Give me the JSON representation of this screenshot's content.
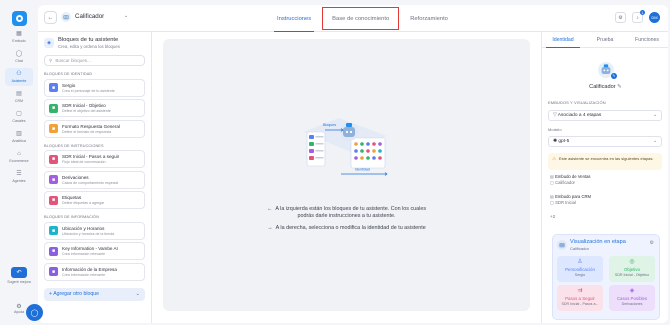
{
  "nav": {
    "items": [
      {
        "label": "Embudo",
        "icon": "grid-icon"
      },
      {
        "label": "Chat",
        "icon": "chat-icon"
      },
      {
        "label": "Asistente",
        "icon": "assistant-icon",
        "active": true
      },
      {
        "label": "CRM",
        "icon": "crm-icon"
      },
      {
        "label": "Canales",
        "icon": "channels-icon"
      },
      {
        "label": "Analítica",
        "icon": "analytics-icon"
      },
      {
        "label": "Ecommerce",
        "icon": "store-icon"
      },
      {
        "label": "Agentes",
        "icon": "agents-icon"
      }
    ],
    "bottom_label": "Sugerir mejora",
    "help_label": "Ayuda"
  },
  "header": {
    "assistant_name": "Calificador",
    "tabs": [
      "Instrucciones",
      "Base de conocimiento",
      "Reforzamiento"
    ],
    "active_tab": 0,
    "highlighted_tab": 1,
    "notification_count": "1",
    "user_initials": "DM"
  },
  "blocks": {
    "title": "Bloques de tu asistente",
    "subtitle": "Crea, edita y ordena los bloques",
    "search_placeholder": "Buscar bloques...",
    "sections": [
      {
        "label": "BLOQUES DE IDENTIDAD",
        "items": [
          {
            "title": "Sergio",
            "subtitle": "Crea el personaje de tu asistente",
            "color": "#5b7ff2"
          },
          {
            "title": "SDR Inicial - Objetivo",
            "subtitle": "Define el objetivo del asistente",
            "color": "#34b36b"
          },
          {
            "title": "Formato Respuesta General",
            "subtitle": "Define el formato de respuesta",
            "color": "#f0a23a"
          }
        ]
      },
      {
        "label": "BLOQUES DE INSTRUCCIONES",
        "items": [
          {
            "title": "SDR Inicial - Pasos a seguir",
            "subtitle": "Flujo ideal de conversación",
            "color": "#e2557a"
          },
          {
            "title": "Derivaciones",
            "subtitle": "Casos de comportamiento especial",
            "color": "#a25fe0"
          },
          {
            "title": "Etiquetas",
            "subtitle": "Define etiquetas a agregar",
            "color": "#e2557a"
          }
        ]
      },
      {
        "label": "BLOQUES DE INFORMACIÓN",
        "items": [
          {
            "title": "Ubicación y Horarios",
            "subtitle": "Ubicación y horarios de la tienda",
            "color": "#1fb5c9"
          },
          {
            "title": "Key Information - Vambe AI",
            "subtitle": "Crea información relevante",
            "color": "#8a5fe0"
          },
          {
            "title": "Información de la Empresa",
            "subtitle": "Crea información relevante",
            "color": "#8a5fe0"
          }
        ]
      }
    ],
    "add_label": "Agregar otro bloque"
  },
  "canvas": {
    "line1": "A la izquierda están los bloques de tu asistente. Con los cuales",
    "line2": "podrás darle instrucciones a tu asistente.",
    "line3": "A la derecha, selecciona o modifica la identidad de tu asistente",
    "illus_label_top": "Bloques",
    "illus_label_bottom": "Identidad"
  },
  "identity": {
    "tabs": [
      "Identidad",
      "Prueba",
      "Funciones"
    ],
    "active_tab": 0,
    "name": "Calificador",
    "funnel_section": "EMBUDOS Y VISUALIZACIÓN",
    "funnel_value": "Asociado a 4 etapas",
    "model_section": "Modelo",
    "model_value": "gpt-5",
    "warning": "Este asistente se encuentra en las siguientes etapas:",
    "links": [
      {
        "title": "Embudo de Ventas",
        "stage": "Calificador"
      },
      {
        "title": "Embudo para CRM",
        "stage": "SDR Inicial"
      }
    ],
    "more": "+2",
    "viz": {
      "title": "Visualización en etapa",
      "subtitle": "Calificador",
      "cards": [
        {
          "title": "Personificación",
          "sub": "Sergio",
          "color": "#5b7ff2",
          "bg": "#dde7ff",
          "icon": "person-icon"
        },
        {
          "title": "Objetivo",
          "sub": "SDR Inicial - Objetivo",
          "color": "#34b36b",
          "bg": "#dff3e6",
          "icon": "target-icon"
        },
        {
          "title": "Pasos a Seguir",
          "sub": "SDR Inicial - Pasos a...",
          "color": "#e2557a",
          "bg": "#fbe2ea",
          "icon": "steps-icon"
        },
        {
          "title": "Casos Posibles",
          "sub": "Derivaciones",
          "color": "#a25fe0",
          "bg": "#eddffb",
          "icon": "cases-icon"
        }
      ]
    }
  }
}
